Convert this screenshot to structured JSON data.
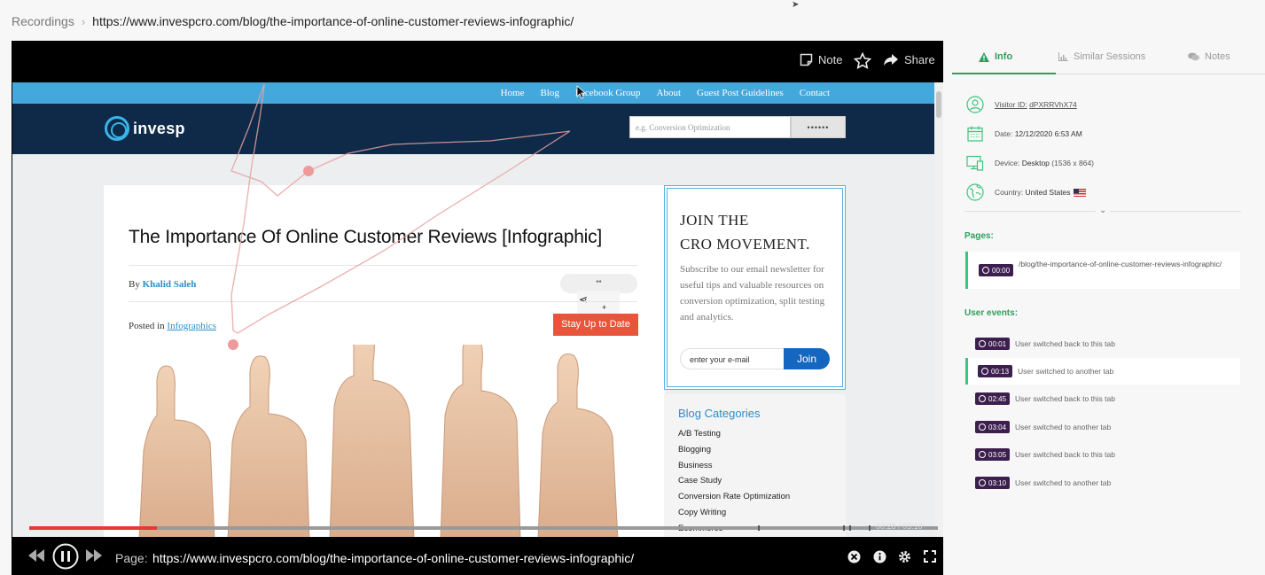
{
  "breadcrumb": {
    "root": "Recordings",
    "url": "https://www.invespcro.com/blog/the-importance-of-online-customer-reviews-infographic/"
  },
  "player": {
    "tools": {
      "note": "Note",
      "share": "Share"
    },
    "site": {
      "nav": [
        "Home",
        "Blog",
        "Facebook Group",
        "About",
        "Guest Post Guidelines",
        "Contact"
      ],
      "logo": "invesp",
      "search_placeholder": "e.g. Conversion Optimization",
      "search_button": "••••••",
      "article": {
        "title": "The Importance Of Online Customer Reviews [Infographic]",
        "by_prefix": "By",
        "author": "Khalid Saleh",
        "share_count": "**",
        "share_plus": "+",
        "posted_prefix": "Posted in",
        "category": "Infographics",
        "cta": "Stay Up to Date"
      },
      "join": {
        "title_line1": "JOIN THE",
        "title_line2": "CRO MOVEMENT.",
        "description": "Subscribe to our email newsletter for useful tips and valuable resources on conversion optimization, split testing and analytics.",
        "email_placeholder": "enter your e-mail",
        "button": "Join"
      },
      "categories": {
        "title": "Blog Categories",
        "items": [
          "A/B Testing",
          "Blogging",
          "Business",
          "Case Study",
          "Conversion Rate Optimization",
          "Copy Writing",
          "Ecommerce"
        ]
      }
    },
    "timeline": {
      "current": "00:28",
      "total": "03:10",
      "time_text": "00:28 / 03:10",
      "progress": 0.14
    },
    "controls": {
      "page_label": "Page:",
      "page_url": "https://www.invespcro.com/blog/the-importance-of-online-customer-reviews-infographic/"
    }
  },
  "panel": {
    "tabs": [
      {
        "label": "Info",
        "icon": "warning-icon",
        "active": true
      },
      {
        "label": "Similar Sessions",
        "icon": "bar-chart-icon",
        "active": false
      },
      {
        "label": "Notes",
        "icon": "chat-icon",
        "active": false
      }
    ],
    "visitor": {
      "label": "Visitor ID:",
      "value": "dPXRRVhX74"
    },
    "date": {
      "label": "Date:",
      "value": "12/12/2020 6:53 AM"
    },
    "device": {
      "label": "Device:",
      "value": "Desktop",
      "resolution": "(1536 x 864)"
    },
    "country": {
      "label": "Country:",
      "value": "United States"
    },
    "pages_label": "Pages:",
    "pages": [
      {
        "time": "00:00",
        "path": "/blog/the-importance-of-online-customer-reviews-infographic/"
      }
    ],
    "events_label": "User events:",
    "events": [
      {
        "time": "00:01",
        "text": "User switched back to this tab",
        "highlight": false
      },
      {
        "time": "00:13",
        "text": "User switched to another tab",
        "highlight": true
      },
      {
        "time": "02:45",
        "text": "User switched back to this tab",
        "highlight": false
      },
      {
        "time": "03:04",
        "text": "User switched to another tab",
        "highlight": false
      },
      {
        "time": "03:05",
        "text": "User switched back to this tab",
        "highlight": false
      },
      {
        "time": "03:10",
        "text": "User switched to another tab",
        "highlight": false
      }
    ]
  },
  "colors": {
    "accent_green": "#2f9e5e",
    "badge_purple": "#3c1f4e",
    "progress_red": "#e53935",
    "site_nav_blue": "#45a8dc",
    "site_header_navy": "#0e2a48"
  }
}
